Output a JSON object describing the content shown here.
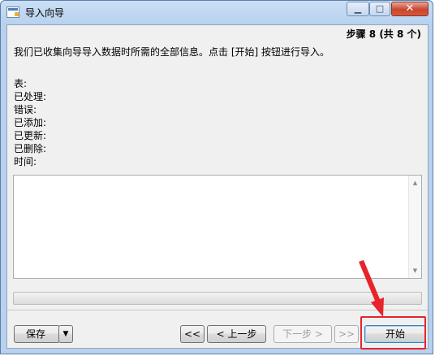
{
  "window": {
    "title": "导入向导",
    "controls": {
      "minimize": "▁",
      "maximize": "□",
      "close": "✕"
    }
  },
  "header": {
    "step": "步骤 8 (共 8 个)"
  },
  "description": "我们已收集向导导入数据时所需的全部信息。点击 [开始] 按钮进行导入。",
  "stats": {
    "table": "表:",
    "processed": "已处理:",
    "errors": "错误:",
    "added": "已添加:",
    "updated": "已更新:",
    "deleted": "已删除:",
    "time": "时间:"
  },
  "log": {
    "scroll_up": "▲",
    "scroll_down": "▼"
  },
  "progress": {
    "value": 0
  },
  "buttons": {
    "save": "保存",
    "save_dropdown": "▼",
    "first": "<<",
    "prev": "< 上一步",
    "next": "下一步 >",
    "last": ">>",
    "start": "开始"
  },
  "annotation": {
    "color": "#e8232b"
  }
}
